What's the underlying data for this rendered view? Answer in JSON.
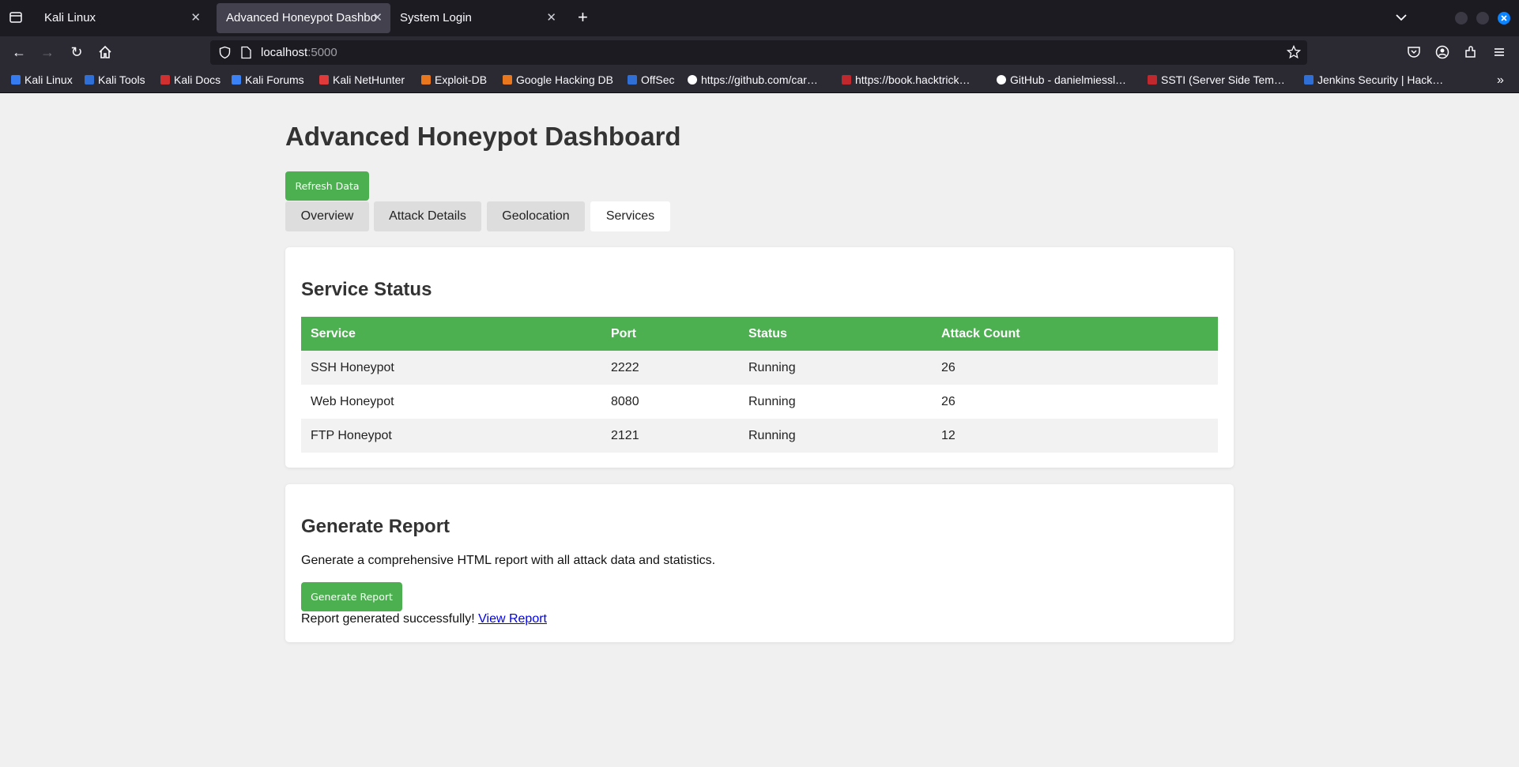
{
  "browser": {
    "tabs": [
      {
        "title": "Kali Linux",
        "active": false
      },
      {
        "title": "Advanced Honeypot Dashboard",
        "active": true
      },
      {
        "title": "System Login",
        "active": false
      }
    ],
    "url_host": "localhost",
    "url_port": ":5000",
    "bookmarks": [
      {
        "label": "Kali Linux",
        "color": "#367bf0"
      },
      {
        "label": "Kali Tools",
        "color": "#2f6fd6"
      },
      {
        "label": "Kali Docs",
        "color": "#d03030"
      },
      {
        "label": "Kali Forums",
        "color": "#3b82f6"
      },
      {
        "label": "Kali NetHunter",
        "color": "#e03a3a"
      },
      {
        "label": "Exploit-DB",
        "color": "#e8771d"
      },
      {
        "label": "Google Hacking DB",
        "color": "#e8771d"
      },
      {
        "label": "OffSec",
        "color": "#2f6fd6"
      },
      {
        "label": "https://github.com/car…",
        "color": "#ffffff"
      },
      {
        "label": "https://book.hacktrick…",
        "color": "#c0282d"
      },
      {
        "label": "GitHub - danielmiessl…",
        "color": "#ffffff"
      },
      {
        "label": "SSTI (Server Side Tem…",
        "color": "#c0282d"
      },
      {
        "label": "Jenkins Security | Hack…",
        "color": "#2f6fd6"
      }
    ]
  },
  "page": {
    "title": "Advanced Honeypot Dashboard",
    "refresh_label": "Refresh Data",
    "tabs": [
      "Overview",
      "Attack Details",
      "Geolocation",
      "Services"
    ],
    "active_tab": "Services"
  },
  "services": {
    "heading": "Service Status",
    "columns": [
      "Service",
      "Port",
      "Status",
      "Attack Count"
    ],
    "rows": [
      [
        "SSH Honeypot",
        "2222",
        "Running",
        "26"
      ],
      [
        "Web Honeypot",
        "8080",
        "Running",
        "26"
      ],
      [
        "FTP Honeypot",
        "2121",
        "Running",
        "12"
      ]
    ]
  },
  "report": {
    "heading": "Generate Report",
    "description": "Generate a comprehensive HTML report with all attack data and statistics.",
    "button_label": "Generate Report",
    "status_text": "Report generated successfully!",
    "link_label": "View Report"
  },
  "colors": {
    "accent": "#4caf50",
    "page_bg": "#f0f0f0"
  }
}
